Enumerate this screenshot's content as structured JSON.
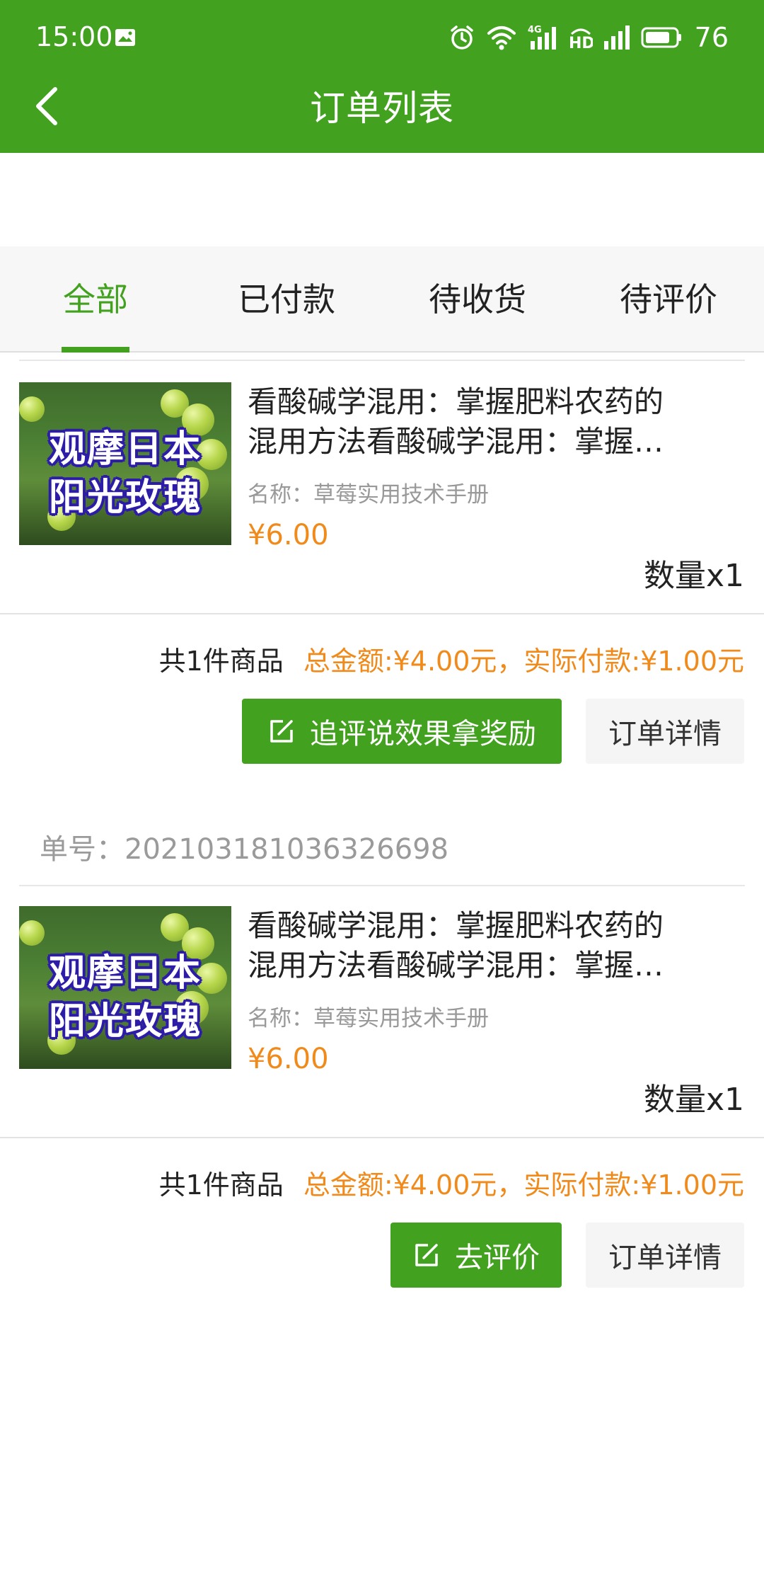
{
  "status_bar": {
    "time": "15:00",
    "battery": "76"
  },
  "header": {
    "title": "订单列表"
  },
  "tabs": [
    {
      "label": "全部",
      "active": true
    },
    {
      "label": "已付款",
      "active": false
    },
    {
      "label": "待收货",
      "active": false
    },
    {
      "label": "待评价",
      "active": false
    }
  ],
  "orders": [
    {
      "order_no": "",
      "thumb_text": [
        "观摩日本",
        "阳光玫瑰"
      ],
      "title_line1": "看酸碱学混用：掌握肥料农药的",
      "title_line2": "混用方法看酸碱学混用：掌握…",
      "name": "名称：草莓实用技术手册",
      "price": "¥6.00",
      "qty": "数量x1",
      "count_text": "共1件商品",
      "amount_text": "总金额:¥4.00元，实际付款:¥1.00元",
      "primary_button": "追评说效果拿奖励",
      "detail_button": "订单详情"
    },
    {
      "order_no": "单号：202103181036326698",
      "thumb_text": [
        "观摩日本",
        "阳光玫瑰"
      ],
      "title_line1": "看酸碱学混用：掌握肥料农药的",
      "title_line2": "混用方法看酸碱学混用：掌握…",
      "name": "名称：草莓实用技术手册",
      "price": "¥6.00",
      "qty": "数量x1",
      "count_text": "共1件商品",
      "amount_text": "总金额:¥4.00元，实际付款:¥1.00元",
      "primary_button": "去评价",
      "detail_button": "订单详情"
    }
  ],
  "colors": {
    "brand_green": "#42a11e",
    "price_orange": "#f08a1a"
  }
}
